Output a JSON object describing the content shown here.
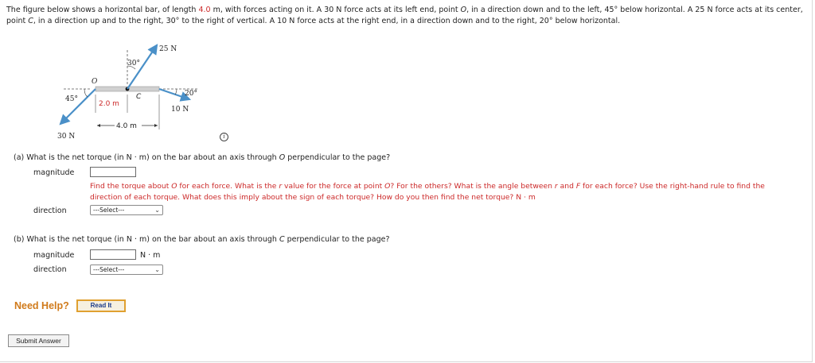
{
  "intro": {
    "p1": "The figure below shows a horizontal bar, of length ",
    "length": "4.0",
    "p2": " m, with forces acting on it. A 30 N force acts at its left end, point ",
    "point_o": "O",
    "p3": ", in a direction down and to the left, 45° below horizontal. A 25 N force acts at its center, point ",
    "point_c": "C",
    "p4": ", in a direction up and to the right, 30° to the right of vertical. A 10 N force acts at the right end, in a direction down and to the right, 20° below horizontal."
  },
  "figure": {
    "force_top": "25 N",
    "angle_top": "30°",
    "point_o": "O",
    "point_c": "C",
    "angle_left": "45°",
    "angle_right": "20°",
    "half_length": "2.0 m",
    "force_right": "10 N",
    "full_length": "4.0 m",
    "force_left": "30 N"
  },
  "info_icon": "i",
  "part_a": {
    "question_pre": "(a)  What is the net torque (in N · m) on the bar about an axis through ",
    "question_point": "O",
    "question_post": " perpendicular to the page?",
    "magnitude_label": "magnitude",
    "magnitude_value": "",
    "hint_1": "Find the torque about ",
    "hint_o1": "O",
    "hint_2": " for each force. What is the ",
    "hint_r1": "r",
    "hint_3": " value for the force at point ",
    "hint_o2": "O",
    "hint_4": "? For the others? What is the angle between ",
    "hint_r2": "r",
    "hint_5": " and ",
    "hint_f": "F",
    "hint_6": " for each force? Use the right-hand rule to find the direction of each torque. What does this imply about the sign of each torque? How do you then find the net torque? N · m",
    "direction_label": "direction",
    "direction_value": "---Select---"
  },
  "part_b": {
    "question_pre": "(b)  What is the net torque (in N · m) on the bar about an axis through ",
    "question_point": "C",
    "question_post": " perpendicular to the page?",
    "magnitude_label": "magnitude",
    "magnitude_value": "",
    "unit": "N · m",
    "direction_label": "direction",
    "direction_value": "---Select---"
  },
  "help": {
    "need_help": "Need Help?",
    "read_it": "Read It"
  },
  "submit": "Submit Answer",
  "colors": {
    "hint_red": "#cc2a2a",
    "arrow_blue": "#4a90c8",
    "need_help_orange": "#d07a1a"
  }
}
